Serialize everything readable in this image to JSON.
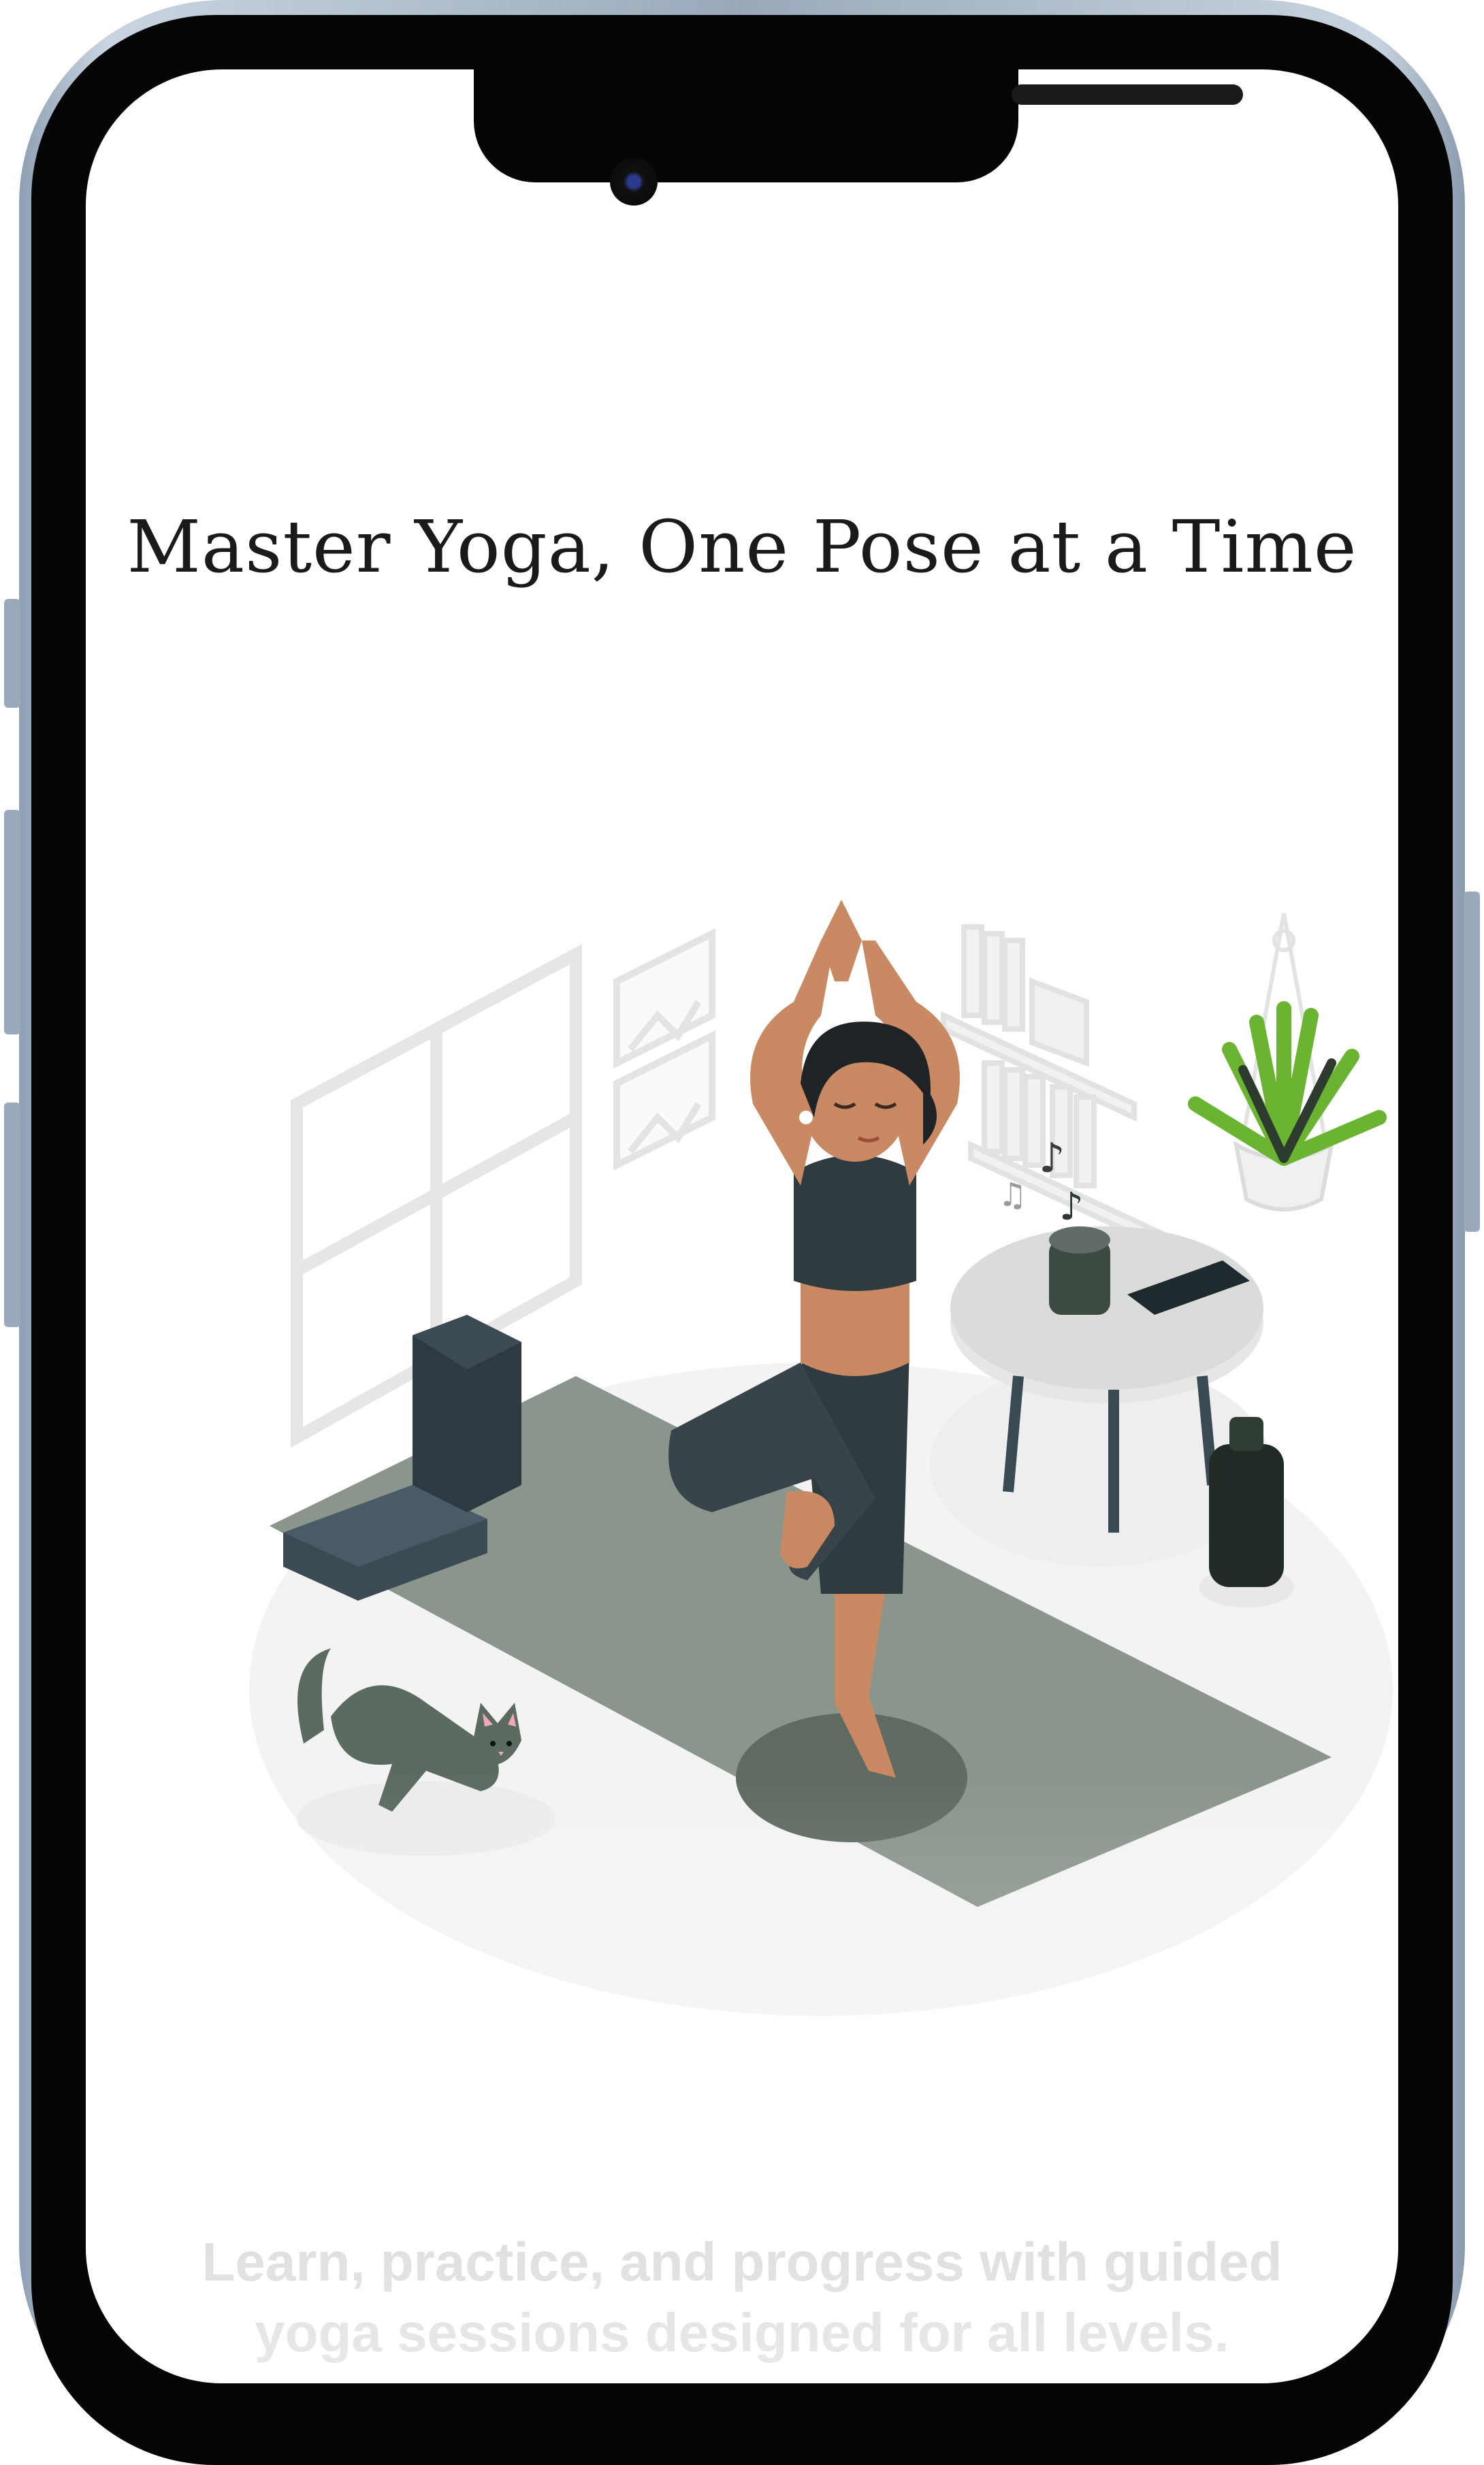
{
  "screen": {
    "title": "Master Yoga, One Pose at a Time",
    "subtitle_line1": "Learn, practice, and progress with guided",
    "subtitle_line2": "yoga sessions designed for all levels."
  },
  "illustration": {
    "icon": "woman-doing-tree-pose-illustration",
    "colors": {
      "mat": "#8a968c",
      "outfit": "#2f3b3f",
      "skin": "#c98a63",
      "hair": "#1e2426",
      "plant": "#6bb431",
      "cat": "#5b6b60",
      "bottle": "#1f2b24"
    }
  },
  "device": {
    "frame_color": "#a9b6c5",
    "screen_color": "#ffffff"
  }
}
